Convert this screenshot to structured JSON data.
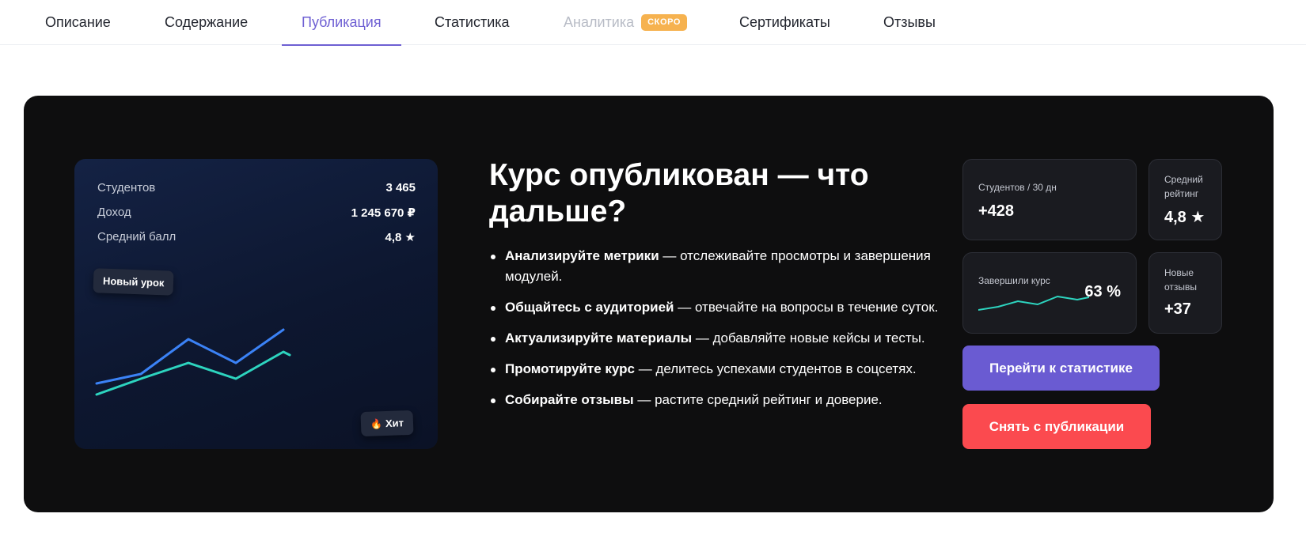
{
  "tabs": [
    {
      "label": "Описание"
    },
    {
      "label": "Содержание"
    },
    {
      "label": "Публикация",
      "active": true
    },
    {
      "label": "Статистика"
    },
    {
      "label": "Аналитика",
      "disabled": true,
      "badge": "СКОРО"
    },
    {
      "label": "Сертификаты"
    },
    {
      "label": "Отзывы"
    }
  ],
  "preview": {
    "rows": [
      {
        "label": "Студентов",
        "value": "3 465"
      },
      {
        "label": "Доход",
        "value": "1 245 670 ₽"
      },
      {
        "label": "Средний балл",
        "value": "4,8 ★"
      }
    ],
    "chip_new": "Новый урок",
    "chip_hit": "Хит",
    "chip_hit_icon": "fire-icon"
  },
  "content": {
    "title": "Курс опубликован — что дальше?",
    "bullets": [
      {
        "bold": "Анализируйте метрики",
        "text": " — отслеживайте просмотры и завершения модулей."
      },
      {
        "bold": "Общайтесь с аудиторией",
        "text": " — отвечайте на вопросы в течение суток."
      },
      {
        "bold": "Актуализируйте материалы",
        "text": " — добавляйте новые кейсы и тесты."
      },
      {
        "bold": "Промотируйте курс",
        "text": " — делитесь успехами студентов в соцсетях."
      },
      {
        "bold": "Собирайте отзывы",
        "text": " — растите средний рейтинг и доверие."
      }
    ]
  },
  "stats": {
    "students_30d": {
      "label": "Студентов / 30 дн",
      "value": "+428"
    },
    "avg_rating": {
      "label": "Средний рейтинг",
      "value": "4,8 ★"
    },
    "completed": {
      "label": "Завершили курс",
      "value": "63 %"
    },
    "new_reviews": {
      "label": "Новые отзывы",
      "value": "+37"
    }
  },
  "buttons": {
    "go_stats": "Перейти к статистике",
    "unpublish": "Снять с публикации"
  },
  "colors": {
    "accent": "#6a5bd2",
    "danger": "#fb4a4f",
    "badge": "#f6b24f",
    "chart_blue": "#3b82f6",
    "chart_teal": "#2dd4bf"
  }
}
